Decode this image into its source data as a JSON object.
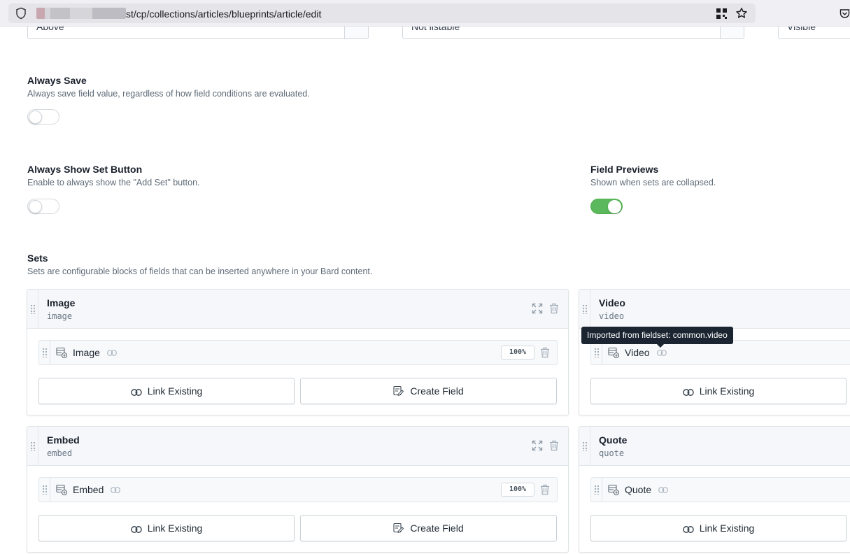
{
  "browser": {
    "url_path": "st/cp/collections/articles/blueprints/article/edit"
  },
  "top_selects": [
    {
      "value": "Above"
    },
    {
      "value": "Not listable"
    },
    {
      "value": "Visible"
    }
  ],
  "always_save": {
    "title": "Always Save",
    "description": "Always save field value, regardless of how field conditions are evaluated.",
    "enabled": false
  },
  "always_show_set_button": {
    "title": "Always Show Set Button",
    "description": "Enable to always show the \"Add Set\" button.",
    "enabled": false
  },
  "field_previews": {
    "title": "Field Previews",
    "description": "Shown when sets are collapsed.",
    "enabled": true,
    "accent_color": "#5cb85c"
  },
  "sets_section": {
    "title": "Sets",
    "description": "Sets are configurable blocks of fields that can be inserted anywhere in your Bard content."
  },
  "sets": [
    {
      "name": "Image",
      "handle": "image",
      "field_label": "Image",
      "width": "100%",
      "link_label": "Link Existing",
      "create_label": "Create Field"
    },
    {
      "name": "Video",
      "handle": "video",
      "field_label": "Video",
      "link_label": "Link Existing"
    },
    {
      "name": "Embed",
      "handle": "embed",
      "field_label": "Embed",
      "width": "100%",
      "link_label": "Link Existing",
      "create_label": "Create Field"
    },
    {
      "name": "Quote",
      "handle": "quote",
      "field_label": "Quote",
      "link_label": "Link Existing"
    }
  ],
  "tooltip": {
    "text": "Imported from fieldset: common.video"
  }
}
